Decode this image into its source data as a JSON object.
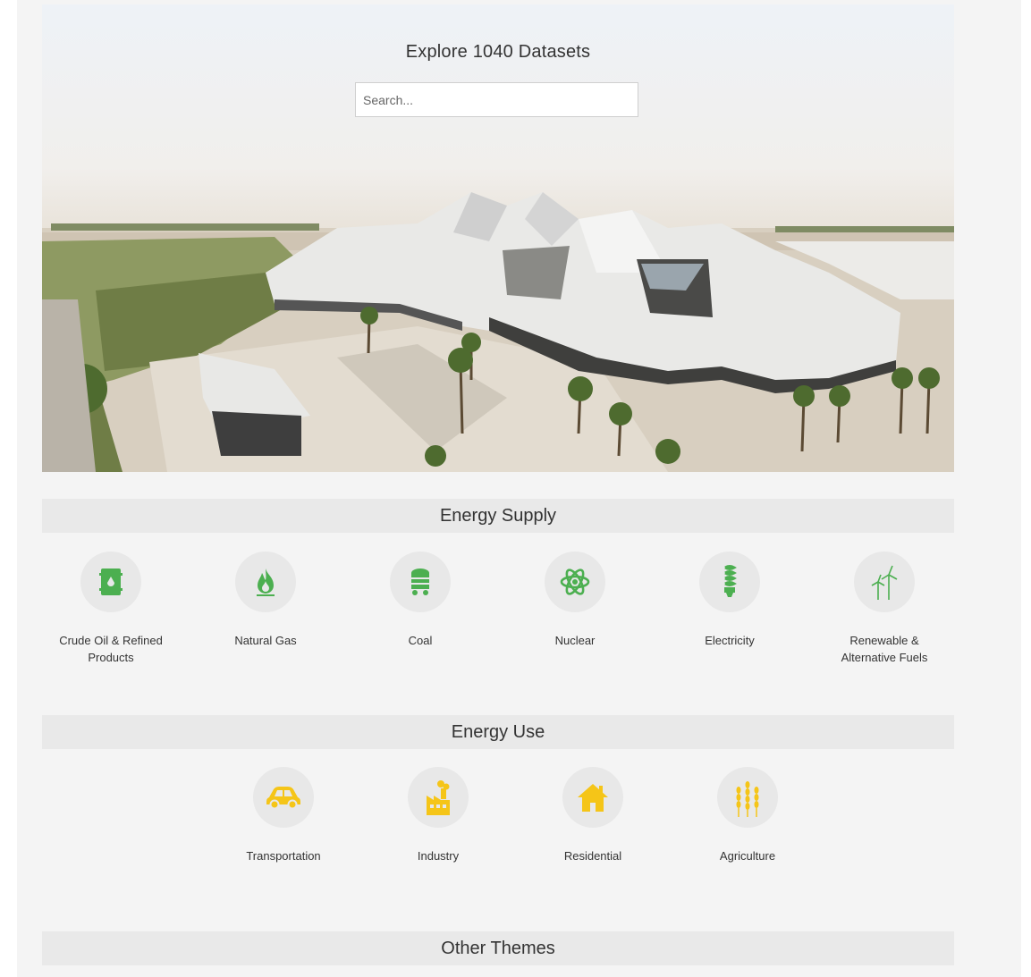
{
  "hero": {
    "title": "Explore 1040 Datasets",
    "search_placeholder": "Search..."
  },
  "sections": {
    "energy_supply": {
      "title": "Energy Supply",
      "items": [
        {
          "label": "Crude Oil & Refined Products",
          "icon": "oil-barrel-icon"
        },
        {
          "label": "Natural Gas",
          "icon": "flame-icon"
        },
        {
          "label": "Coal",
          "icon": "coal-cart-icon"
        },
        {
          "label": "Nuclear",
          "icon": "atom-icon"
        },
        {
          "label": "Electricity",
          "icon": "light-bulb-icon"
        },
        {
          "label": "Renewable & Alternative Fuels",
          "icon": "wind-turbine-icon"
        }
      ]
    },
    "energy_use": {
      "title": "Energy Use",
      "items": [
        {
          "label": "Transportation",
          "icon": "car-icon"
        },
        {
          "label": "Industry",
          "icon": "factory-icon"
        },
        {
          "label": "Residential",
          "icon": "house-icon"
        },
        {
          "label": "Agriculture",
          "icon": "wheat-icon"
        }
      ]
    },
    "other_themes": {
      "title": "Other Themes"
    }
  },
  "colors": {
    "supply_icon": "#4caf50",
    "use_icon": "#f5c518",
    "header_bg": "#e9e9e9",
    "page_bg": "#f4f4f4"
  }
}
